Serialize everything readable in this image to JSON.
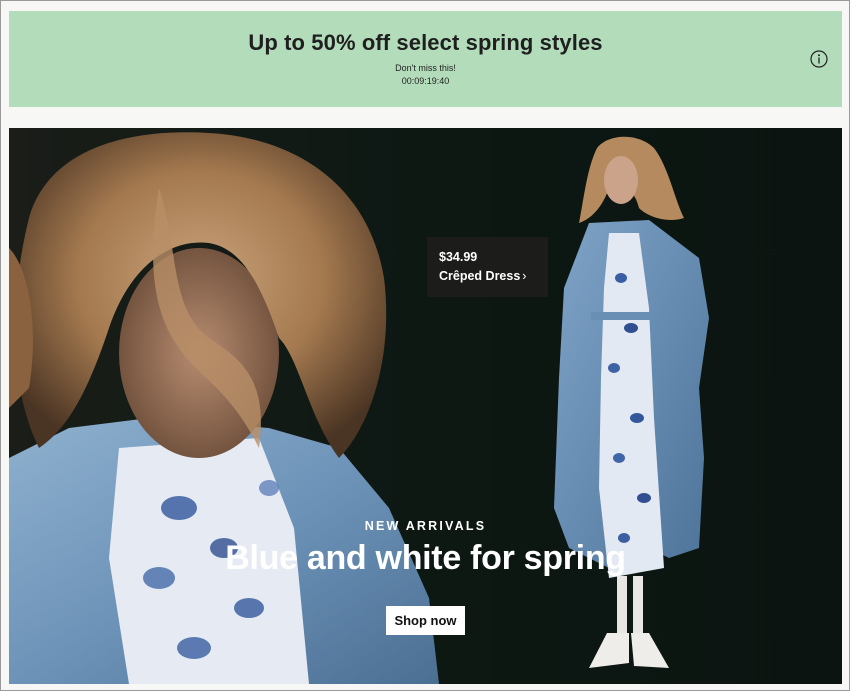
{
  "promo": {
    "title": "Up to 50% off select spring styles",
    "subtitle": "Don't miss this!",
    "countdown": "00:09:19:40",
    "info_icon": "info-circle-icon",
    "background_color": "#b3dcbb"
  },
  "hero": {
    "product_tag": {
      "price": "$34.99",
      "name": "Crêped Dress",
      "chevron": "›"
    },
    "eyebrow": "NEW ARRIVALS",
    "headline": "Blue and white for spring",
    "cta_label": "Shop now",
    "background_color": "#0f1914"
  }
}
